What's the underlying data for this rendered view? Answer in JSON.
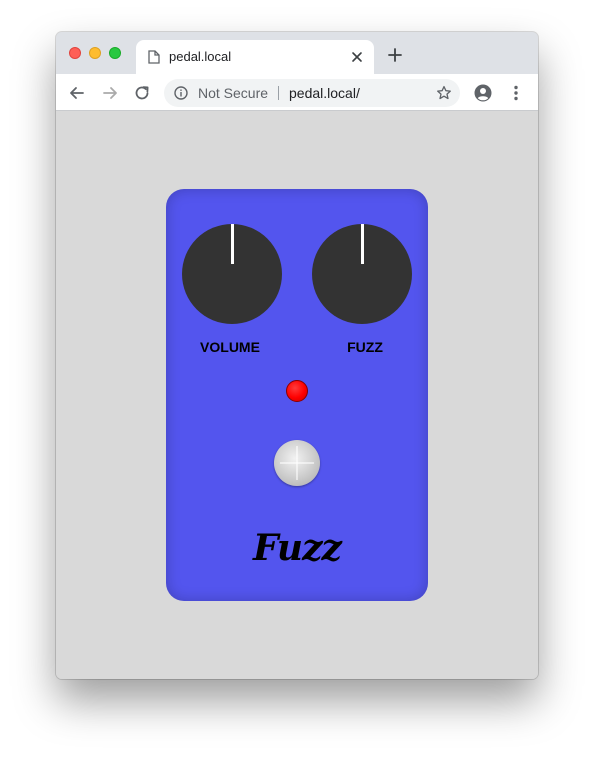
{
  "browser": {
    "tab": {
      "title": "pedal.local",
      "page_icon": "page-icon",
      "close_icon": "close-icon"
    },
    "new_tab_icon": "plus-icon",
    "toolbar": {
      "back_icon": "back-arrow-icon",
      "forward_icon": "forward-arrow-icon",
      "reload_icon": "reload-icon",
      "security_label": "Not Secure",
      "url": "pedal.local/",
      "bookmark_icon": "star-icon",
      "profile_icon": "account-icon",
      "menu_icon": "more-vert-icon"
    }
  },
  "pedal": {
    "body_color": "#5355ee",
    "knobs": [
      {
        "label": "VOLUME",
        "color": "#333333"
      },
      {
        "label": "FUZZ",
        "color": "#333333"
      }
    ],
    "led": {
      "state": "on",
      "color": "#ff0000"
    },
    "footswitch_icon": "footswitch",
    "name": "Fuzz"
  }
}
